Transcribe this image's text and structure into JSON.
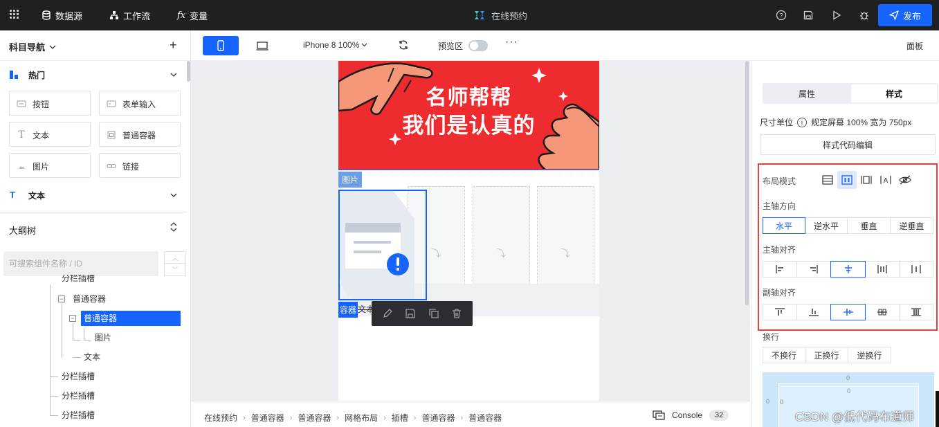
{
  "topbar": {
    "datasource": "数据源",
    "workflow": "工作流",
    "variables": "变量",
    "app_title": "在线预约",
    "publish": "发布"
  },
  "left": {
    "title": "科目导航",
    "sections": {
      "hot": "热门",
      "text": "文本"
    },
    "components": {
      "button": "按钮",
      "form_input": "表单输入",
      "text": "文本",
      "container": "普通容器",
      "image": "图片",
      "link": "链接"
    },
    "outline": {
      "title": "大纲树",
      "search_placeholder": "可搜索组件名称 / ID",
      "nodes": {
        "partial": "分栏插槽",
        "container1": "普通容器",
        "container2": "普通容器",
        "image": "图片",
        "text": "文本",
        "slot1": "分栏插槽",
        "slot2": "分栏插槽",
        "slot3": "分栏插槽"
      }
    }
  },
  "toolbar": {
    "device": "iPhone 8 100%",
    "preview": "预览区",
    "more": "···",
    "panel": "面板"
  },
  "canvas": {
    "banner_line1": "名师帮帮",
    "banner_line2": "我们是认真的",
    "image_tag": "图片",
    "container_tag": "容器",
    "text_tag": "文本"
  },
  "bottombar": {
    "breadcrumbs": [
      "在线预约",
      "普通容器",
      "普通容器",
      "网格布局",
      "插槽",
      "普通容器",
      "普通容器"
    ],
    "console": "Console",
    "console_count": "32"
  },
  "right": {
    "tabs": {
      "props": "属性",
      "style": "样式"
    },
    "unit_label": "尺寸单位",
    "unit_value": "规定屏幕 100% 宽为 750px",
    "code_edit": "样式代码编辑",
    "layout_mode": "布局模式",
    "main_axis_direction": "主轴方向",
    "directions": [
      "水平",
      "逆水平",
      "垂直",
      "逆垂直"
    ],
    "main_axis_align": "主轴对齐",
    "cross_axis_align": "副轴对齐",
    "wrap": "换行",
    "wrap_options": [
      "不换行",
      "正换行",
      "逆换行"
    ],
    "box_values": {
      "outer_top": "0",
      "inner_top": "0",
      "left": "0",
      "inner_left": "0"
    }
  },
  "watermark": "CSDN @低代码布道师",
  "colors": {
    "accent": "#1664ff",
    "banner": "#ee2b2f",
    "highlight": "#e8403c",
    "topbar": "#1f2022"
  }
}
